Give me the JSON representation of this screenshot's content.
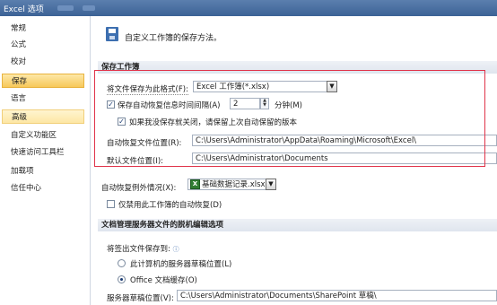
{
  "window": {
    "title": "Excel 选项"
  },
  "sidebar": {
    "items": [
      {
        "label": "常规"
      },
      {
        "label": "公式"
      },
      {
        "label": "校对"
      },
      {
        "label": "保存"
      },
      {
        "label": "语言"
      },
      {
        "label": "高级"
      },
      {
        "label": "自定义功能区"
      },
      {
        "label": "快速访问工具栏"
      },
      {
        "label": "加载项"
      },
      {
        "label": "信任中心"
      }
    ],
    "selected": "保存"
  },
  "header": {
    "text": "自定义工作簿的保存方法。",
    "icon": "save-icon"
  },
  "save_section": {
    "title": "保存工作簿",
    "format_label": "将文件保存为此格式(F):",
    "format_value": "Excel 工作簿(*.xlsx)",
    "autorecover_label": "保存自动恢复信息时间间隔(A)",
    "autorecover_checked": true,
    "interval_value": "2",
    "minutes_label": "分钟(M)",
    "keep_last_label": "如果我没保存就关闭，请保留上次自动保留的版本",
    "keep_last_checked": true,
    "autorecover_location_label": "自动恢复文件位置(R):",
    "autorecover_location_value": "C:\\Users\\Administrator\\AppData\\Roaming\\Microsoft\\Excel\\",
    "default_location_label": "默认文件位置(I):",
    "default_location_value": "C:\\Users\\Administrator\\Documents"
  },
  "exceptions": {
    "label": "自动恢复例外情况(X):",
    "workbook_value": "基础数据记录.xlsx",
    "disable_label": "仅禁用此工作簿的自动恢复(D)",
    "disable_checked": false
  },
  "offline_section": {
    "title": "文档管理服务器文件的脱机编辑选项",
    "save_to_label": "将签出文件保存到:",
    "option1_label": "此计算机的服务器草稿位置(L)",
    "option1_selected": false,
    "option2_label": "Office 文档缓存(O)",
    "option2_selected": true,
    "drafts_label": "服务器草稿位置(V):",
    "drafts_value": "C:\\Users\\Administrator\\Documents\\SharePoint 草稿\\"
  },
  "colors": {
    "highlight": "#e0344a",
    "selected_item": "#f7c85a",
    "section_bg": "#e4e9f0"
  }
}
